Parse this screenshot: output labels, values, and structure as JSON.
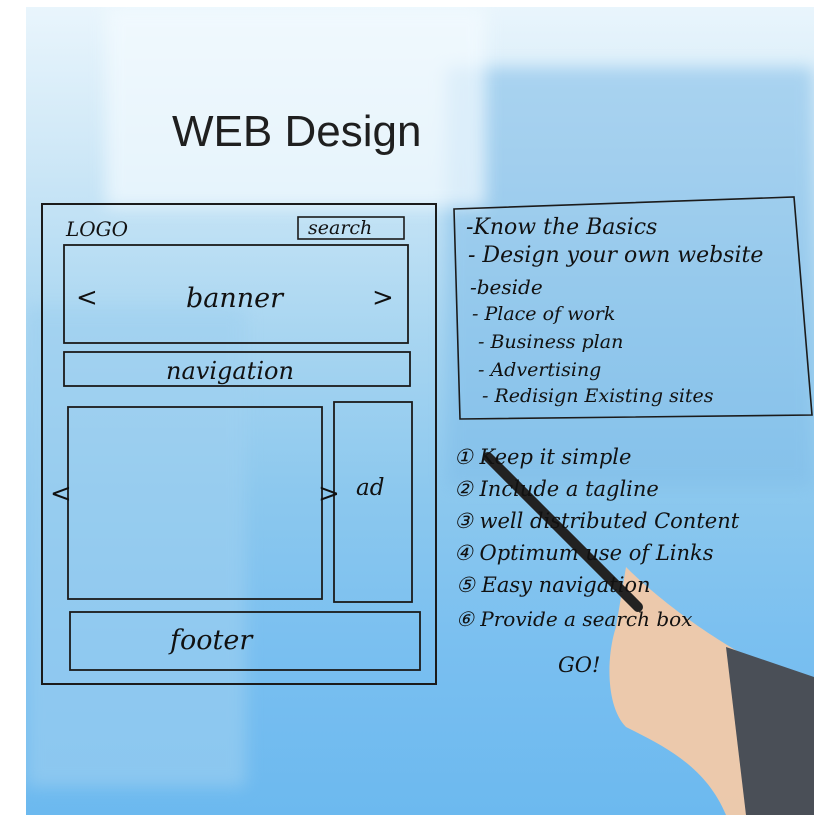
{
  "title": "WEB Design",
  "wireframe": {
    "logo": "LOGO",
    "search": "search",
    "banner": "banner",
    "banner_prev": "<",
    "banner_next": ">",
    "navigation": "navigation",
    "content_prev": "<",
    "content_next": ">",
    "ad": "ad",
    "footer": "footer"
  },
  "basics": [
    "-Know the Basics",
    "- Design your own website",
    "-beside",
    "- Place of work",
    "- Business plan",
    "- Advertising",
    "- Redisign Existing sites"
  ],
  "tips": [
    "① Keep it simple",
    "② Include a tagline",
    "③ well distributed Content",
    "④ Optimum use of Links",
    "⑤ Easy navigation",
    "⑥ Provide a search box"
  ],
  "go": "GO!",
  "colors": {
    "ink": "#111111",
    "sky": "#8cc8ee",
    "suit": "#4a4f57",
    "skin": "#f2c9a8"
  }
}
